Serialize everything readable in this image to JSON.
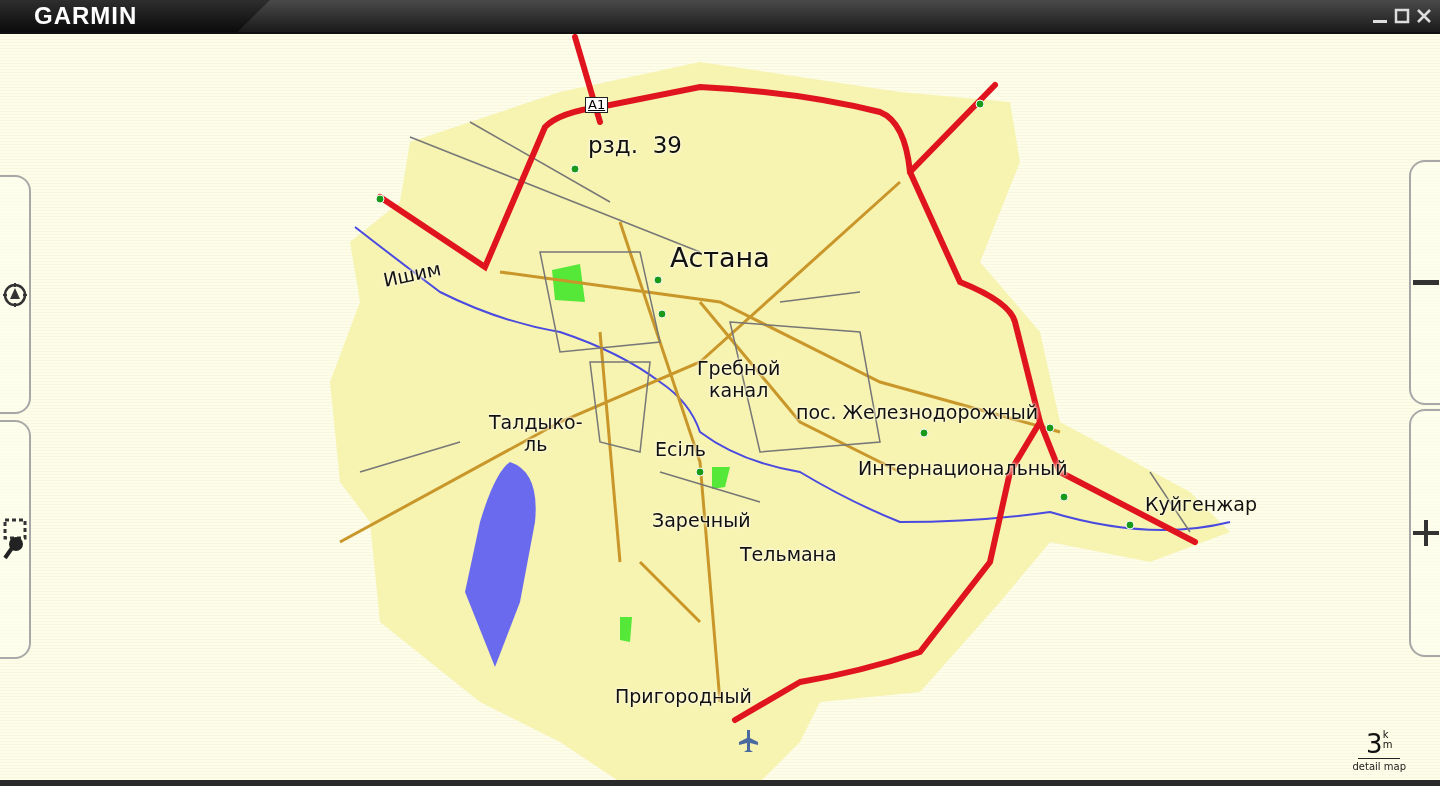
{
  "title_bar": {
    "logo": "GARMIN"
  },
  "map": {
    "route_shield": "A1",
    "labels": [
      {
        "kind": "station",
        "lines": [
          "рзд.  39"
        ]
      },
      {
        "kind": "city",
        "lines": [
          "Астана"
        ]
      },
      {
        "kind": "river",
        "lines": [
          "Ишим"
        ]
      },
      {
        "kind": "district",
        "lines": [
          "Гребной",
          "канал"
        ]
      },
      {
        "kind": "district",
        "lines": [
          "Талдыко-",
          "ль"
        ]
      },
      {
        "kind": "district",
        "lines": [
          "Есіль"
        ]
      },
      {
        "kind": "district",
        "lines": [
          "пос. Железнодорожный"
        ]
      },
      {
        "kind": "district",
        "lines": [
          "Интернациональный"
        ]
      },
      {
        "kind": "district",
        "lines": [
          "Куйгенжар"
        ]
      },
      {
        "kind": "district",
        "lines": [
          "Заречный"
        ]
      },
      {
        "kind": "district",
        "lines": [
          "Тельмана"
        ]
      },
      {
        "kind": "district",
        "lines": [
          "Пригородный"
        ]
      }
    ]
  },
  "scale": {
    "value": "3",
    "unit_top": "k",
    "unit_bottom": "m",
    "caption": "detail map"
  }
}
